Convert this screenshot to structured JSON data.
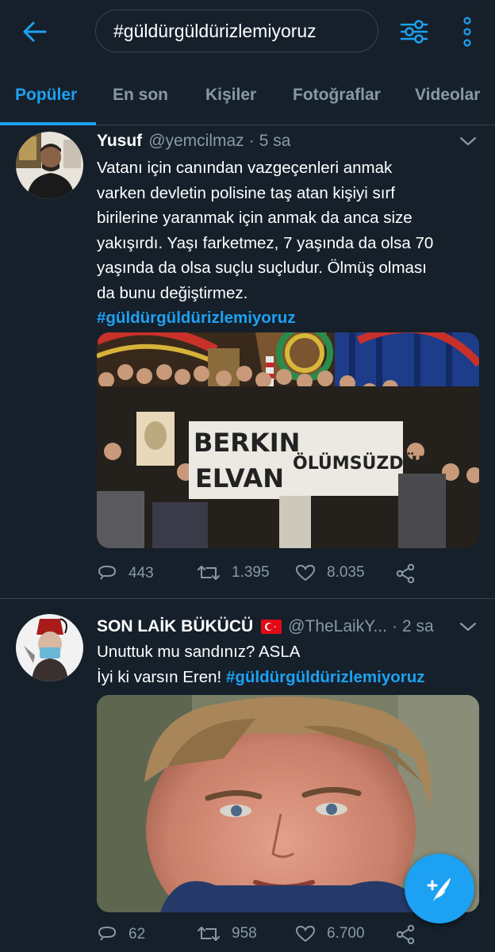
{
  "colors": {
    "background": "#15202b",
    "accent": "#1da1f2",
    "muted": "#8899a6",
    "border": "#38444d"
  },
  "header": {
    "search_query": "#güldürgüldürizlemiyoruz",
    "back_icon": "arrow-left-icon",
    "filter_icon": "sliders-icon",
    "more_icon": "vertical-dots-icon"
  },
  "tabs": [
    {
      "label": "Popüler",
      "active": true
    },
    {
      "label": "En son",
      "active": false
    },
    {
      "label": "Kişiler",
      "active": false
    },
    {
      "label": "Fotoğraflar",
      "active": false
    },
    {
      "label": "Videolar",
      "active": false
    }
  ],
  "tweets": [
    {
      "name": "Yusuf",
      "handle": "@yemcilmaz",
      "time": "5 sa",
      "text_lines": [
        "Vatanı için canından vazgeçenleri anmak",
        "varken devletin polisine taş atan kişiyi sırf",
        "birilerine yaranmak için anmak da anca size",
        "yakışırdı. Yaşı farketmez, 7 yaşında da olsa 70",
        "yaşında da olsa suçlu suçludur. Ölmüş olması",
        "da bunu değiştirmez."
      ],
      "hashtag": "#güldürgüldürizlemiyoruz",
      "media": {
        "banner_left_line1": "BERKIN",
        "banner_left_line2": "ELVAN",
        "banner_right": "ÖLÜMSÜZDÜR"
      },
      "replies": "443",
      "retweets": "1.395",
      "likes": "8.035"
    },
    {
      "name": "SON LAİK BÜKÜCÜ",
      "flag": "🇹🇷",
      "handle": "@TheLaikY...",
      "time": "2 sa",
      "text_line1": "Unuttuk mu sandınız? ASLA",
      "text_line2_prefix": "İyi ki varsın Eren! ",
      "hashtag": "#güldürgüldürizlemiyoruz",
      "replies": "62",
      "retweets": "958",
      "likes": "6.700"
    }
  ],
  "fab": {
    "icon": "compose-tweet-icon",
    "glyph": "+"
  }
}
